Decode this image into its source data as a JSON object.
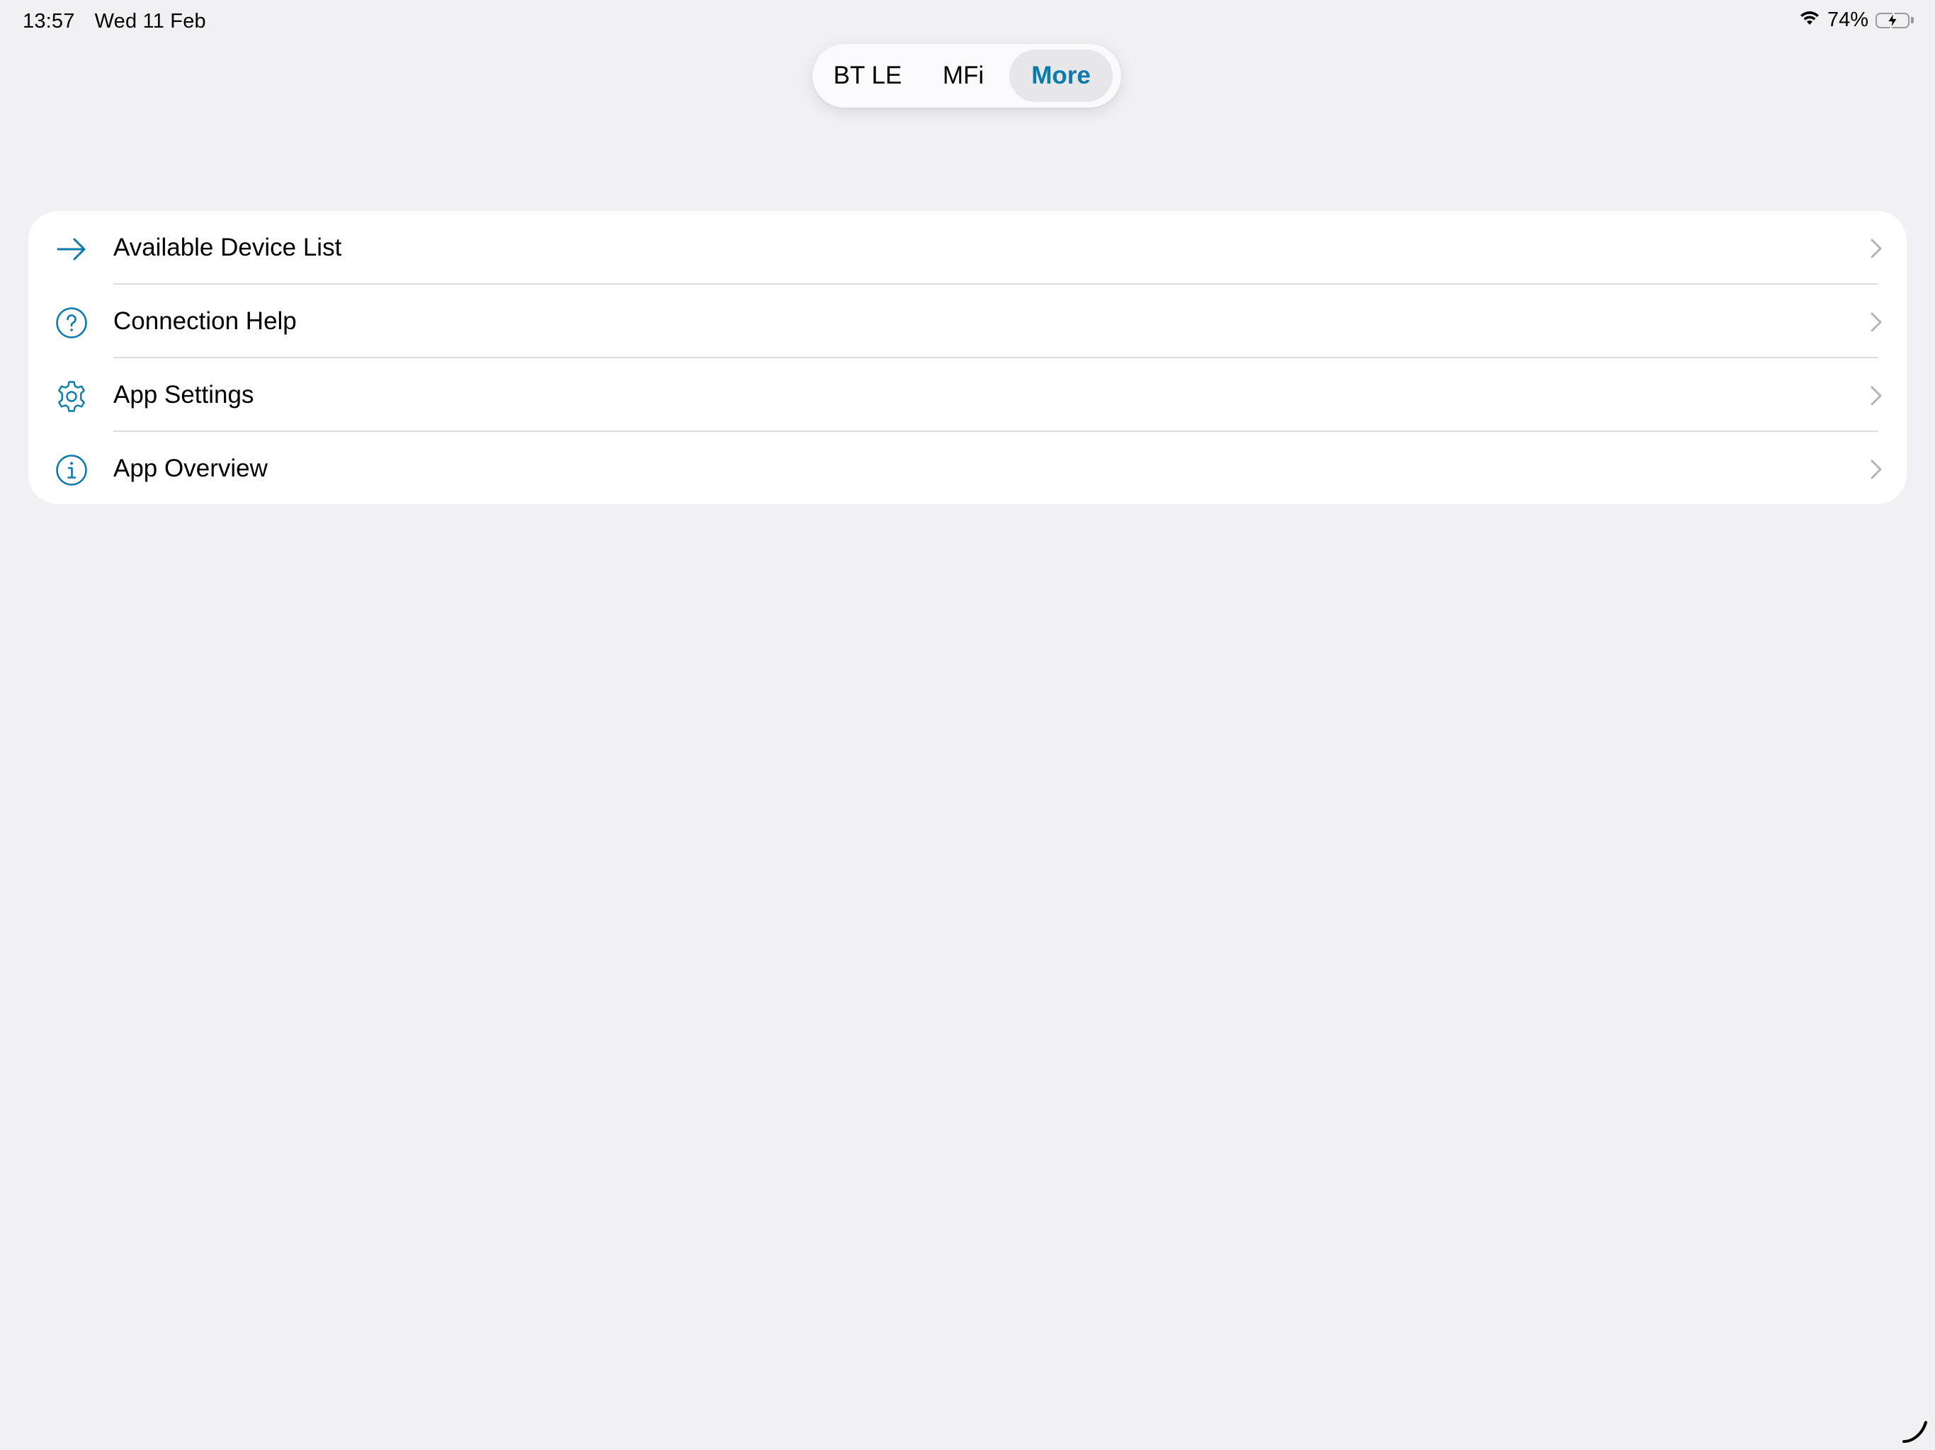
{
  "status_bar": {
    "time": "13:57",
    "date": "Wed 11 Feb",
    "battery_percent": "74%",
    "battery_level": 0.74,
    "icons": [
      "wifi-icon",
      "battery-charging-icon"
    ]
  },
  "segmented_control": {
    "items": [
      {
        "label": "BT LE",
        "selected": false
      },
      {
        "label": "MFi",
        "selected": false
      },
      {
        "label": "More",
        "selected": true
      }
    ]
  },
  "menu": {
    "items": [
      {
        "label": "Available Device List",
        "icon": "arrow-right-icon"
      },
      {
        "label": "Connection Help",
        "icon": "question-circle-icon"
      },
      {
        "label": "App Settings",
        "icon": "gear-icon"
      },
      {
        "label": "App Overview",
        "icon": "info-circle-icon"
      }
    ]
  },
  "colors": {
    "accent": "#0a7bab",
    "background": "#f1f0f5",
    "card": "#ffffff",
    "battery": "#34c759"
  }
}
